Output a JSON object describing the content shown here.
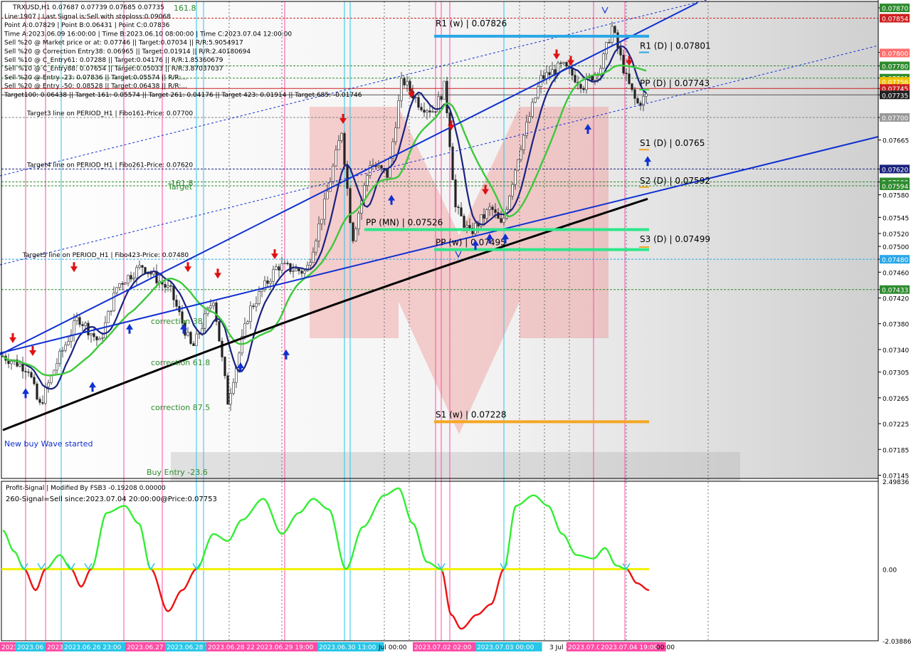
{
  "chart_data": [
    {
      "type": "candlestick",
      "symbol_line": "TRXUSD,H1  0.07687 0.07739 0.07685 0.07735",
      "info_lines": [
        "Line:1907 | Last Signal is:Sell with stoploss:0.09068",
        "Point A:0.07829 | Point B:0.06431 | Point C:0.07836",
        "Time A:2023.06.09 16:00:00 | Time B:2023.06.10 08:00:00 | Time C:2023.07.04 12:00:00",
        "Sell %20 @ Market price or at: 0.07746 || Target:0.07034 || R/R:5.9054917",
        "Sell %20 @ Correction Entry38: 0.06965 || Target:0.01914 || R/R:2.40180694",
        "Sell %10 @ C_Entry61: 0.07288 || Target:0.04176 || R/R:1.85360679",
        "Sell %10 @ C_Entry88: 0.07654 || Target:0.05033 || R/R:3.87037037",
        "Sell %20 @ Entry -23: 0.07836 || Target:0.05574 || R/R:...",
        "Sell %20 @ Entry -50: 0.08528 || Target:0.06438 || R/R:...",
        "Target100: 0.06438 || Target 161: 0.05574 || Target 261: 0.04176 || Target 423: 0.01914 || Target 685: -0.01746"
      ],
      "price_axis": [
        "0.07870",
        "0.07801",
        "0.07780",
        "0.07761",
        "0.07745",
        "0.07735",
        "0.07700",
        "0.07665",
        "0.07620",
        "0.07600",
        "0.07580",
        "0.07545",
        "0.07520",
        "0.07500",
        "0.07480",
        "0.07460",
        "0.07433",
        "0.07420",
        "0.07380",
        "0.07340",
        "0.07305",
        "0.07265",
        "0.07225",
        "0.07185",
        "0.07145"
      ],
      "price_min": 0.0714,
      "price_max": 0.0788,
      "pivot_levels": [
        {
          "label": "R1 (w) | 0.07826",
          "price": 0.07826,
          "color": "#29a7e8"
        },
        {
          "label": "R1 (D) | 0.07801",
          "price": 0.07801,
          "color": "#29a7e8"
        },
        {
          "label": "PP (D) | 0.07743",
          "price": 0.07743,
          "color": "#2ee65c"
        },
        {
          "label": "S1 (D) | 0.0765",
          "price": 0.0765,
          "color": "#f5a623"
        },
        {
          "label": "S2 (D) | 0.07592",
          "price": 0.07592,
          "color": "#f5a623"
        },
        {
          "label": "PP (MN) | 0.07526",
          "price": 0.07526,
          "color": "#2ee68a"
        },
        {
          "label": "PP (w) | 0.07495",
          "price": 0.07495,
          "color": "#2ee68a"
        },
        {
          "label": "S3 (D) | 0.07499",
          "price": 0.07499,
          "color": "#f5a623"
        },
        {
          "label": "S1 (w) | 0.07228",
          "price": 0.07228,
          "color": "#f5a623"
        }
      ],
      "target_lines": [
        {
          "label": "Target3 line on PERIOD_H1 | Fibo161-Price: 0.07700",
          "price": 0.077
        },
        {
          "label": "Target4 line on PERIOD_H1 | Fibo261-Price: 0.07620",
          "price": 0.0762
        },
        {
          "label": "Target5 line on PERIOD_H1 | Fibo423-Price: 0.07480",
          "price": 0.0748
        }
      ],
      "price_tags": [
        {
          "price": "0.07870",
          "bg": "#2e8b2e"
        },
        {
          "price": "0.07854",
          "bg": "#cc2020"
        },
        {
          "price": "0.07800",
          "bg": "#ff6d6d"
        },
        {
          "price": "0.07780",
          "bg": "#2e8b2e"
        },
        {
          "price": "0.07761",
          "bg": "#2e8b2e"
        },
        {
          "price": "0.07756",
          "bg": "#f0c000"
        },
        {
          "price": "0.07745",
          "bg": "#cc2020"
        },
        {
          "price": "0.07735",
          "bg": "#222222"
        },
        {
          "price": "0.07700",
          "bg": "#999999"
        },
        {
          "price": "0.07620",
          "bg": "#1a237e"
        },
        {
          "price": "0.07600",
          "bg": "#2e8b2e"
        },
        {
          "price": "0.07594",
          "bg": "#2e8b2e"
        },
        {
          "price": "0.07480",
          "bg": "#29a7e8"
        },
        {
          "price": "0.07433",
          "bg": "#2e8b2e"
        }
      ],
      "annotations": [
        "correction 38",
        "correction 61.8",
        "correction 87.5",
        "New buy Wave started",
        "Buy Entry -23.6",
        "161.8",
        "Target",
        "-161.8"
      ]
    },
    {
      "type": "line",
      "title": "Profit-Signal | Modified By FSB3 -0.19208 0.00000",
      "subtitle": "260-Signal=Sell since:2023.07.04 20:00:00@Price:0.07753",
      "y_axis": [
        "2.49836",
        "0.00",
        "-2.03886"
      ],
      "ylim": [
        -2.03886,
        2.49836
      ]
    }
  ],
  "time_labels": [
    "2023.06",
    "2023.06",
    "2023.06",
    "2023.06.26 23:00",
    "2023.06.27 23:00",
    "2023.06.28 12:00",
    "2023.06.28 22:00",
    "2023.06.29 19:00",
    "2023.06.30 13:00",
    "Jul 00:00",
    "2023.07.02 02:00",
    "2023.07.03 00:00",
    "3 Jul 1",
    "2023.07.0",
    "2023.07.04 19:00",
    "00:00"
  ]
}
